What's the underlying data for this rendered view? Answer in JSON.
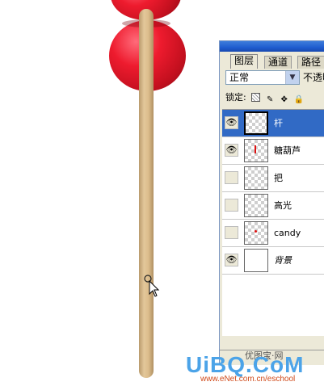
{
  "panel": {
    "tabs": [
      {
        "label": "图层"
      },
      {
        "label": "通道"
      },
      {
        "label": "路径"
      }
    ],
    "blend_mode": "正常",
    "opacity_label": "不透明",
    "lock_label": "锁定:",
    "layers": [
      {
        "name": "杆",
        "visible": true,
        "selected": true
      },
      {
        "name": "糖葫芦",
        "visible": true,
        "selected": false
      },
      {
        "name": "把",
        "visible": false,
        "selected": false
      },
      {
        "name": "高光",
        "visible": false,
        "selected": false
      },
      {
        "name": "candy",
        "visible": false,
        "selected": false
      },
      {
        "name": "背景",
        "visible": true,
        "selected": false
      }
    ]
  },
  "watermark": {
    "logo": "UiBQ.CoM",
    "subtitle": "优图宝·网",
    "url": "www.eNet.com.cn/eschool"
  },
  "colors": {
    "candy": "#ee1b2e",
    "stick": "#dcbd8c",
    "selection": "#316ac5"
  }
}
